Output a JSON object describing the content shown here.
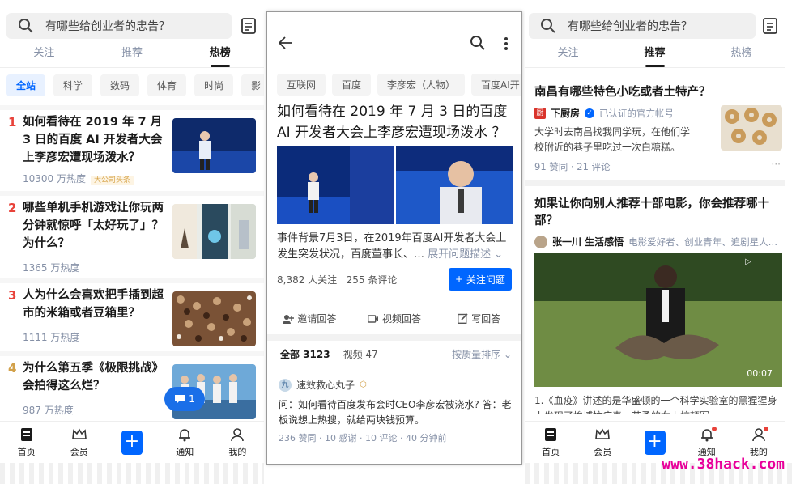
{
  "left": {
    "search_placeholder": "有哪些给创业者的忠告？",
    "tabs": [
      "关注",
      "推荐",
      "热榜"
    ],
    "active_tab": 2,
    "chips": [
      "全站",
      "科学",
      "数码",
      "体育",
      "时尚",
      "影"
    ],
    "items": [
      {
        "rank": "1",
        "title": "如何看待在 2019 年 7 月 3 日的百度 AI 开发者大会上李彦宏遭现场泼水？",
        "heat": "10300 万热度",
        "tag": "大公司头条"
      },
      {
        "rank": "2",
        "title": "哪些单机手机游戏让你玩两分钟就惊呼「太好玩了」？为什么？",
        "heat": "1365 万热度",
        "tag": ""
      },
      {
        "rank": "3",
        "title": "人为什么会喜欢把手插到超市的米箱或者豆箱里？",
        "heat": "1111 万热度",
        "tag": ""
      },
      {
        "rank": "4",
        "title": "为什么第五季《极限挑战》会拍得这么烂？",
        "heat": "987 万热度",
        "tag": ""
      }
    ],
    "fab_count": "1",
    "nav": [
      "首页",
      "会员",
      "通知",
      "我的"
    ]
  },
  "middle": {
    "tags": [
      "互联网",
      "百度",
      "李彦宏（人物）",
      "百度AI开"
    ],
    "question": "如何看待在 2019 年 7 月 3 日的百度 AI 开发者大会上李彦宏遭现场泼水 ？",
    "description": "事件背景7月3日，在2019年百度AI开发者大会上发生突发状况，百度董事长、…",
    "expand": "展开问题描述",
    "followers": "8,382 人关注",
    "comments": "255 条评论",
    "follow_btn": "关注问题",
    "actions": [
      "邀请回答",
      "视频回答",
      "写回答"
    ],
    "answer_tabs": [
      "全部 3123",
      "视频 47"
    ],
    "sort": "按质量排序",
    "author": "速效救心丸子",
    "author_avatar": "九",
    "answer": "问：如何看待百度发布会时CEO李彦宏被浇水? 答：老板说想上热搜，就给两块钱预算。",
    "answer_meta": "236 赞同 · 10 感谢 · 10 评论 · 40 分钟前"
  },
  "right": {
    "search_placeholder": "有哪些给创业者的忠告？",
    "tabs": [
      "关注",
      "推荐",
      "热榜"
    ],
    "active_tab": 1,
    "card1": {
      "title": "南昌有哪些特色小吃或者土特产？",
      "source": "下厨房",
      "verified": "已认证的官方帐号",
      "text": "大学时去南昌找我同学玩，在他们学校附近的巷子里吃过一次白糖糕。",
      "meta": "91 赞同 · 21 评论"
    },
    "card2": {
      "title": "如果让你向别人推荐十部电影，你会推荐哪十部？",
      "author": "张一川 生活感悟",
      "bio": "电影爱好者、创业青年、追剧星人…",
      "duration": "00:07",
      "text": "1.《血疫》讲述的是华盛顿的一个科学实验室的黑猩猩身上发现了埃博拉病毒，英勇的女上校顿军"
    },
    "nav": [
      "首页",
      "会员",
      "通知",
      "我的"
    ]
  },
  "watermark": "www.38hack.com"
}
